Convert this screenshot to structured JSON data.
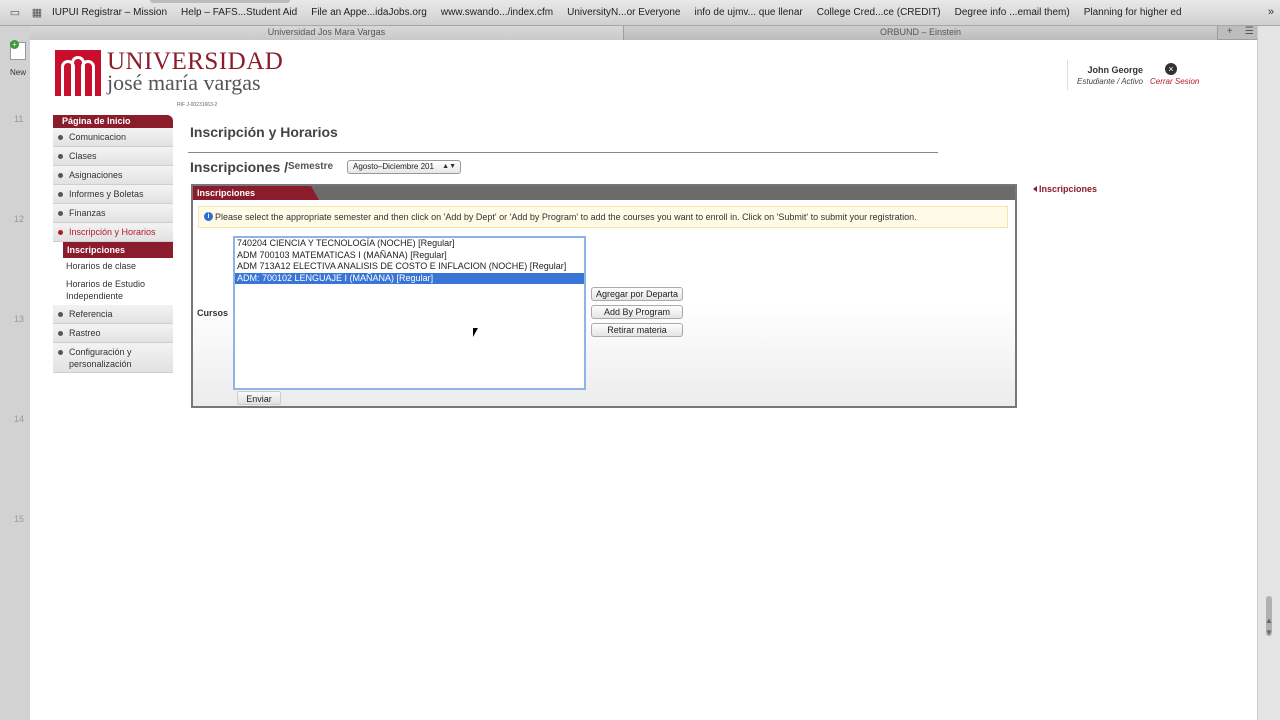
{
  "browser": {
    "bookmarks": [
      "IUPUI Registrar – Mission",
      "Help – FAFS...Student Aid",
      "File an Appe...idaJobs.org",
      "www.swando.../index.cfm",
      "UniversityN...or Everyone",
      "info de ujmv... que llenar",
      "College Cred...ce (CREDIT)",
      "Degree info ...email them)",
      "Planning for higher ed"
    ],
    "more": "»",
    "tabs": [
      "Universidad Jos Mara Vargas",
      "ORBUND – Einstein"
    ],
    "tab_buttons": [
      "+",
      "☰"
    ],
    "gutter_new": "New",
    "gutter_lines": [
      "11",
      "12",
      "13",
      "14",
      "15"
    ]
  },
  "logo": {
    "line1": "UNIVERSIDAD",
    "line2": "josé maría vargas",
    "rif": "RIF J-00231663-2"
  },
  "user": {
    "name": "John George",
    "role": "Estudiante / Activo",
    "logout": "Cerrar Sesion",
    "logout_icon": "×"
  },
  "sidebar": {
    "header": "Página de Inicio",
    "items": [
      {
        "label": "Comunicacion"
      },
      {
        "label": "Clases"
      },
      {
        "label": "Asignaciones"
      },
      {
        "label": "Informes y Boletas"
      },
      {
        "label": "Finanzas"
      },
      {
        "label": "Inscripción y Horarios"
      }
    ],
    "subitems": [
      "Inscripciones",
      "Horarios de clase",
      "Horarios de Estudio Independiente"
    ],
    "after": [
      "Referencia",
      "Rastreo",
      "Configuración y personalización"
    ]
  },
  "main": {
    "title": "Inscripción y Horarios",
    "subtitle": "Inscripciones",
    "slash": "/",
    "semester_label": "Semestre",
    "semester_value": "Agosto–Diciembre 201",
    "panel_tab": "Inscripciones",
    "notice": "Please select the appropriate semester and then click on 'Add by Dept' or 'Add by Program' to add the courses you want to enroll in. Click on 'Submit' to submit your registration.",
    "info_icon": "i",
    "cursos_label": "Cursos",
    "courses": [
      "740204 CIENCIA Y TECNOLOGÍA (NOCHE) [Regular]",
      "ADM 700103 MATEMATICAS I (MAÑANA) [Regular]",
      "ADM 713A12 ELECTIVA ANALISIS DE COSTO E INFLACION (NOCHE) [Regular]",
      "ADM: 700102 LENGUAJE I (MAÑANA) [Regular]"
    ],
    "selected_index": 3,
    "buttons": {
      "add_dept": "Agregar por Departa",
      "add_program": "Add By Program",
      "remove": "Retirar materia"
    },
    "submit": "Enviar"
  },
  "right_link": "Inscripciones",
  "colors": {
    "brand": "#8a1c2b",
    "accent_red": "#b2182b",
    "selection": "#3875d7"
  }
}
